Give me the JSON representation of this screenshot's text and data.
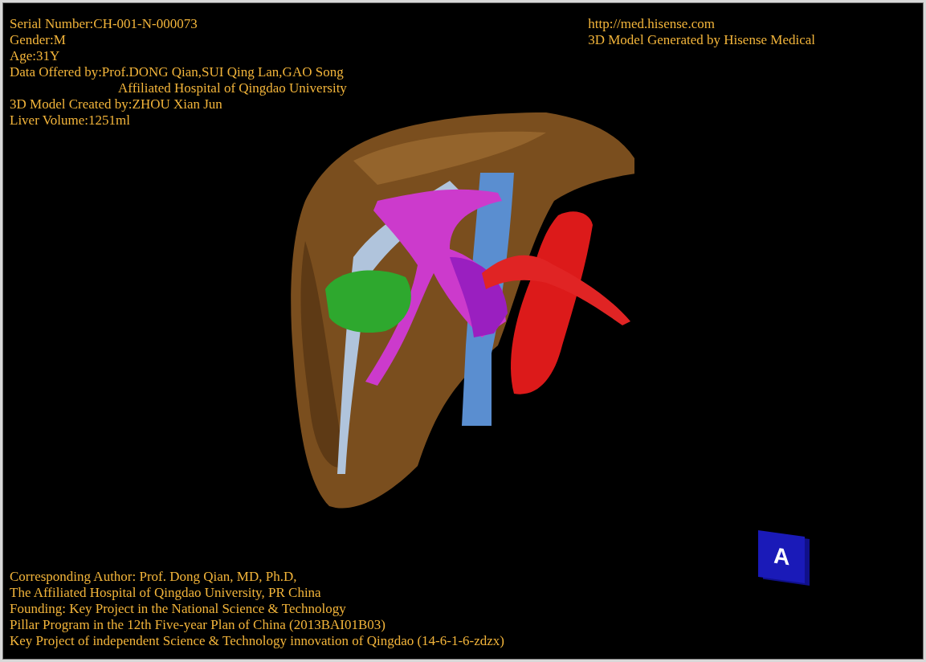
{
  "info_left": [
    "Serial Number:CH-001-N-000073",
    "Gender:M",
    "Age:31Y",
    "Data Offered by:Prof.DONG Qian,SUI Qing Lan,GAO Song",
    "Affiliated Hospital of Qingdao University",
    "3D Model Created by:ZHOU Xian Jun",
    "Liver Volume:1251ml"
  ],
  "info_right": [
    "http://med.hisense.com",
    "3D Model Generated by Hisense Medical"
  ],
  "orientation_cube": {
    "label": "A"
  },
  "credits": [
    "Corresponding Author: Prof. Dong Qian, MD, Ph.D,",
    "The Affiliated Hospital of Qingdao University, PR China",
    "Founding: Key Project in the National Science & Technology",
    "Pillar Program in the 12th Five-year Plan of China (2013BAI01B03)",
    "Key Project of independent Science & Technology innovation of Qingdao (14-6-1-6-zdzx)"
  ]
}
